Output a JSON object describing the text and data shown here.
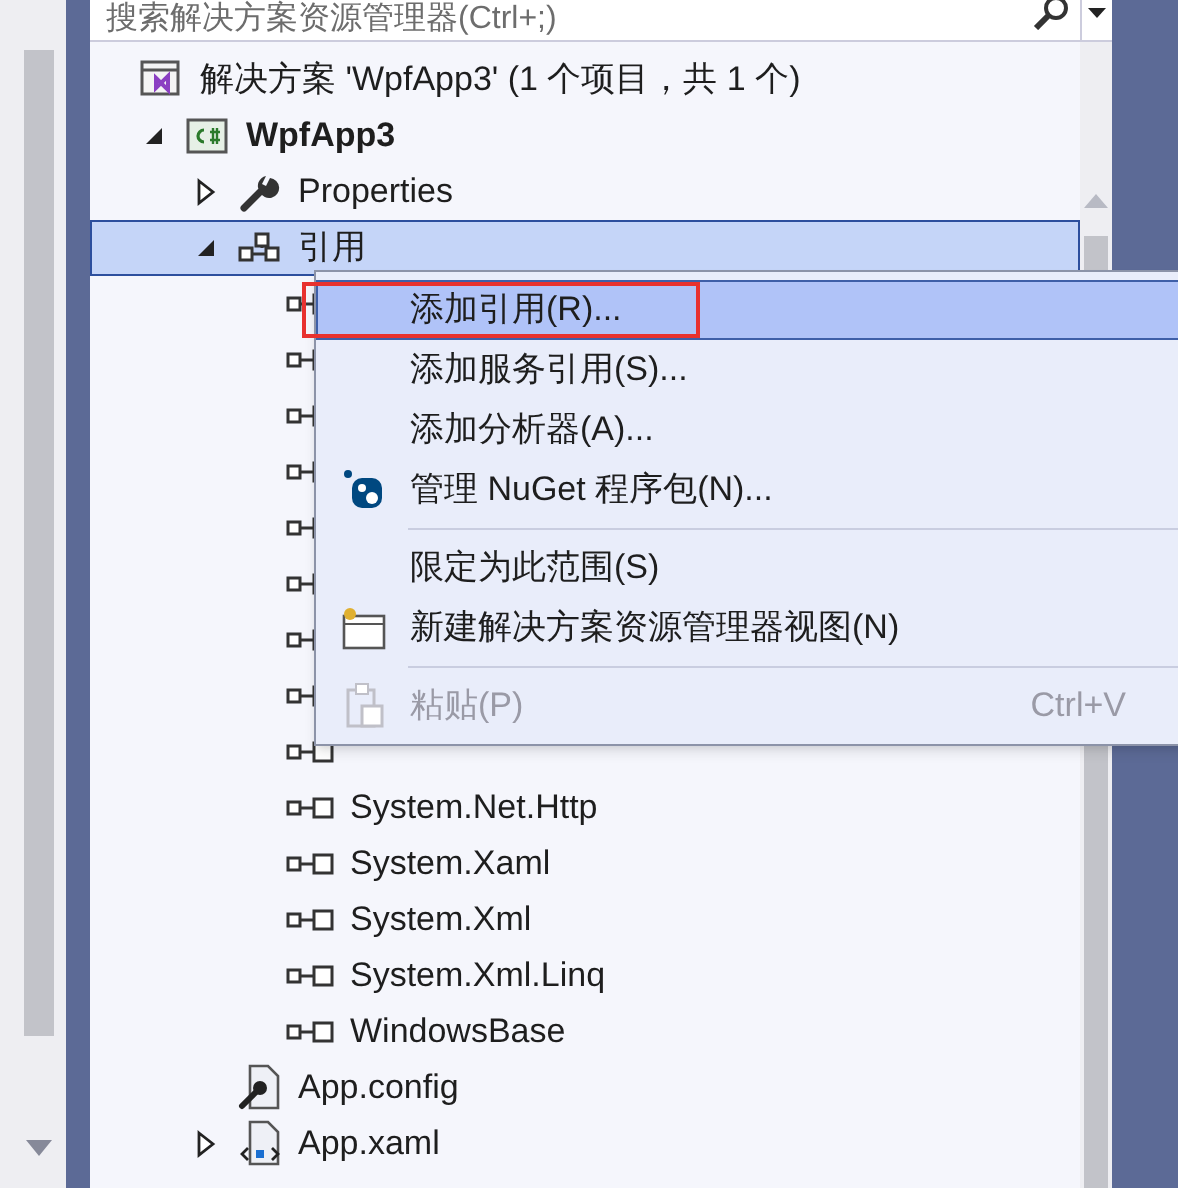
{
  "search": {
    "placeholder": "搜索解决方案资源管理器(Ctrl+;)"
  },
  "tree": [
    {
      "kind": "solution",
      "label": "解决方案 'WpfApp3' (1 个项目，共 1 个)",
      "selected": false,
      "children": [
        {
          "kind": "project",
          "label": "WpfApp3",
          "expanded": true,
          "selected": false,
          "children": [
            {
              "kind": "properties",
              "label": "Properties",
              "expanded": false,
              "selected": false
            },
            {
              "kind": "references",
              "label": "引用",
              "expanded": true,
              "selected": true,
              "children": [
                {
                  "kind": "reference",
                  "selected": false
                },
                {
                  "kind": "reference",
                  "selected": false
                },
                {
                  "kind": "reference",
                  "selected": false
                },
                {
                  "kind": "reference",
                  "selected": false
                },
                {
                  "kind": "reference",
                  "selected": false
                },
                {
                  "kind": "reference",
                  "selected": false
                },
                {
                  "kind": "reference",
                  "selected": false
                },
                {
                  "kind": "reference",
                  "selected": false
                },
                {
                  "kind": "reference",
                  "selected": false
                },
                {
                  "kind": "reference",
                  "label": "System.Net.Http",
                  "selected": false
                },
                {
                  "kind": "reference",
                  "label": "System.Xaml",
                  "selected": false
                },
                {
                  "kind": "reference",
                  "label": "System.Xml",
                  "selected": false
                },
                {
                  "kind": "reference",
                  "label": "System.Xml.Linq",
                  "selected": false
                },
                {
                  "kind": "reference",
                  "label": "WindowsBase",
                  "selected": false
                }
              ]
            },
            {
              "kind": "config",
              "label": "App.config",
              "selected": false
            },
            {
              "kind": "xaml",
              "label": "App.xaml",
              "expanded": false,
              "selected": false
            }
          ]
        }
      ]
    }
  ],
  "context_menu": [
    {
      "kind": "item",
      "label": "添加引用(R)...",
      "selected": true,
      "annotated": true,
      "disabled": false
    },
    {
      "kind": "item",
      "label": "添加服务引用(S)...",
      "selected": false,
      "annotated": false,
      "disabled": false
    },
    {
      "kind": "item",
      "label": "添加分析器(A)...",
      "selected": false,
      "annotated": false,
      "disabled": false
    },
    {
      "kind": "item",
      "label": "管理 NuGet 程序包(N)...",
      "selected": false,
      "annotated": false,
      "disabled": false
    },
    {
      "kind": "separator"
    },
    {
      "kind": "item",
      "label": "限定为此范围(S)",
      "selected": false,
      "annotated": false,
      "disabled": false
    },
    {
      "kind": "item",
      "label": "新建解决方案资源管理器视图(N)",
      "selected": false,
      "annotated": false,
      "disabled": false
    },
    {
      "kind": "separator"
    },
    {
      "kind": "item",
      "label": "粘贴(P)",
      "shortcut": "Ctrl+V",
      "selected": false,
      "annotated": false,
      "disabled": true
    }
  ]
}
